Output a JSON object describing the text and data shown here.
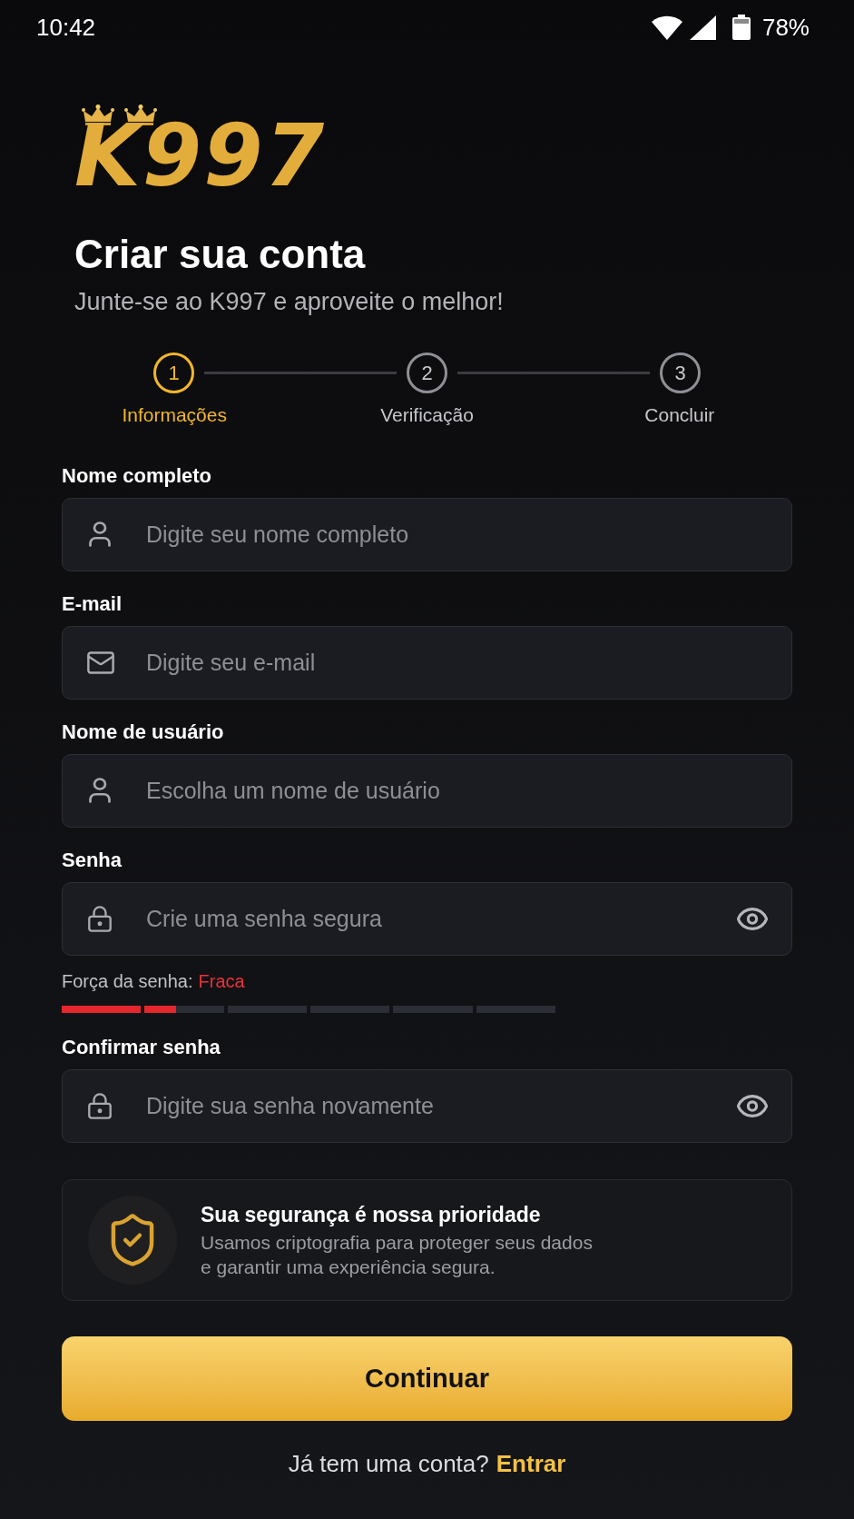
{
  "status_bar": {
    "time": "10:42",
    "battery": "78%"
  },
  "logo": {
    "text": "K997"
  },
  "header": {
    "title": "Criar sua conta",
    "subtitle": "Junte-se ao K997 e aproveite o melhor!"
  },
  "stepper": [
    {
      "number": "1",
      "label": "Informações",
      "active": true
    },
    {
      "number": "2",
      "label": "Verificação",
      "active": false
    },
    {
      "number": "3",
      "label": "Concluir",
      "active": false
    }
  ],
  "fields": [
    {
      "kind": "text",
      "label": "Nome completo",
      "placeholder": "Digite seu nome completo"
    },
    {
      "kind": "email",
      "label": "E-mail",
      "placeholder": "Digite seu e-mail"
    },
    {
      "kind": "text",
      "label": "Nome de usuário",
      "placeholder": "Escolha um nome de usuário"
    },
    {
      "kind": "password",
      "label": "Senha",
      "placeholder": "Crie uma senha segura",
      "strength": {
        "label": "Força da senha:",
        "value": "Fraca",
        "level": 0.23
      }
    },
    {
      "kind": "password",
      "label": "Confirmar senha",
      "placeholder": "Digite sua senha novamente"
    }
  ],
  "security_card": {
    "title": "Sua segurança é nossa prioridade",
    "text": "Usamos criptografia para proteger seus dados\ne garantir uma experiência segura."
  },
  "continue_button": {
    "label": "Continuar"
  },
  "login_prompt": {
    "text": "Já tem uma conta?",
    "link": "Entrar"
  }
}
